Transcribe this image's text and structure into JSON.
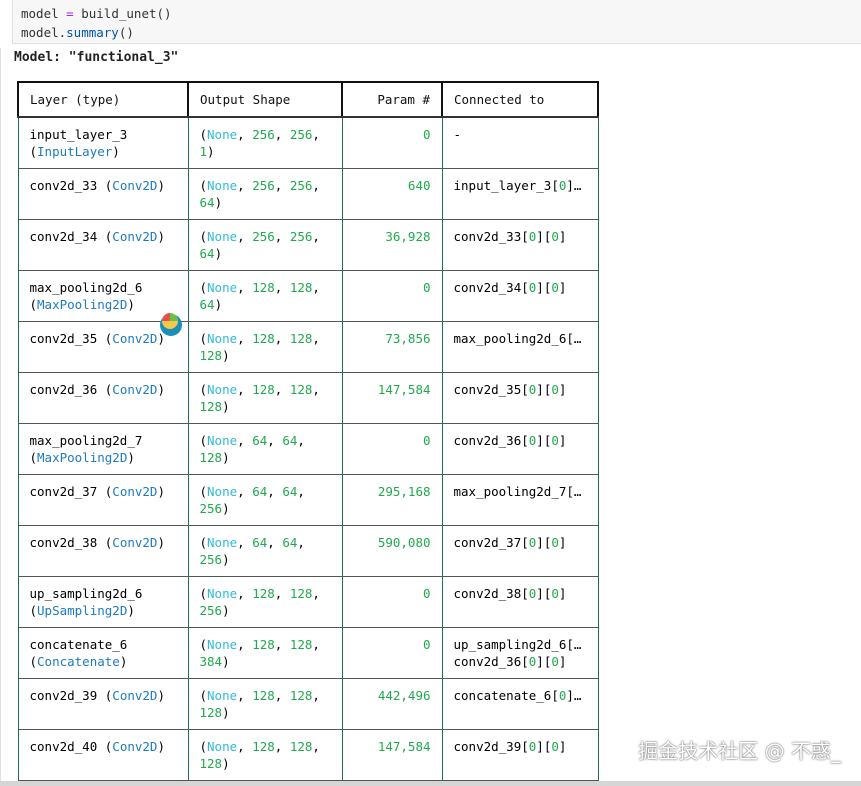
{
  "code": {
    "line1": {
      "var": "model",
      "op": "=",
      "fn": "build_unet",
      "args": "()"
    },
    "line2": {
      "obj": "model.",
      "fn": "summary",
      "args": "()"
    }
  },
  "model_title": "Model: \"functional_3\"",
  "table": {
    "headers": [
      "Layer (type)",
      "Output Shape",
      "Param #",
      "Connected to"
    ],
    "rows": [
      {
        "name": "input_layer_3",
        "type": "InputLayer",
        "type_wrap": true,
        "d1": "256",
        "d2": "256",
        "d3": "1",
        "params": "0",
        "connected": [
          "-"
        ]
      },
      {
        "name": "conv2d_33",
        "type": "Conv2D",
        "type_wrap": false,
        "d1": "256",
        "d2": "256",
        "d3": "64",
        "params": "640",
        "connected": [
          "input_layer_3[0]…"
        ]
      },
      {
        "name": "conv2d_34",
        "type": "Conv2D",
        "type_wrap": false,
        "d1": "256",
        "d2": "256",
        "d3": "64",
        "params": "36,928",
        "connected": [
          "conv2d_33[0][0]"
        ]
      },
      {
        "name": "max_pooling2d_6",
        "type": "MaxPooling2D",
        "type_wrap": true,
        "d1": "128",
        "d2": "128",
        "d3": "64",
        "params": "0",
        "connected": [
          "conv2d_34[0][0]"
        ]
      },
      {
        "name": "conv2d_35",
        "type": "Conv2D",
        "type_wrap": false,
        "d1": "128",
        "d2": "128",
        "d3": "128",
        "params": "73,856",
        "connected": [
          "max_pooling2d_6[…"
        ]
      },
      {
        "name": "conv2d_36",
        "type": "Conv2D",
        "type_wrap": false,
        "d1": "128",
        "d2": "128",
        "d3": "128",
        "params": "147,584",
        "connected": [
          "conv2d_35[0][0]"
        ]
      },
      {
        "name": "max_pooling2d_7",
        "type": "MaxPooling2D",
        "type_wrap": true,
        "d1": "64",
        "d2": "64",
        "d3": "128",
        "params": "0",
        "connected": [
          "conv2d_36[0][0]"
        ]
      },
      {
        "name": "conv2d_37",
        "type": "Conv2D",
        "type_wrap": false,
        "d1": "64",
        "d2": "64",
        "d3": "256",
        "params": "295,168",
        "connected": [
          "max_pooling2d_7[…"
        ]
      },
      {
        "name": "conv2d_38",
        "type": "Conv2D",
        "type_wrap": false,
        "d1": "64",
        "d2": "64",
        "d3": "256",
        "params": "590,080",
        "connected": [
          "conv2d_37[0][0]"
        ]
      },
      {
        "name": "up_sampling2d_6",
        "type": "UpSampling2D",
        "type_wrap": true,
        "d1": "128",
        "d2": "128",
        "d3": "256",
        "params": "0",
        "connected": [
          "conv2d_38[0][0]"
        ]
      },
      {
        "name": "concatenate_6",
        "type": "Concatenate",
        "type_wrap": true,
        "d1": "128",
        "d2": "128",
        "d3": "384",
        "params": "0",
        "connected": [
          "up_sampling2d_6[…",
          "conv2d_36[0][0]"
        ]
      },
      {
        "name": "conv2d_39",
        "type": "Conv2D",
        "type_wrap": false,
        "d1": "128",
        "d2": "128",
        "d3": "128",
        "params": "442,496",
        "connected": [
          "concatenate_6[0]…"
        ]
      },
      {
        "name": "conv2d_40",
        "type": "Conv2D",
        "type_wrap": false,
        "d1": "128",
        "d2": "128",
        "d3": "128",
        "params": "147,584",
        "connected": [
          "conv2d_39[0][0]"
        ]
      }
    ]
  },
  "none_label": "None",
  "watermark": "掘金技术社区 @ 不惑_",
  "colors": {
    "class": "#1d7bbf",
    "none": "#31b9d8",
    "number": "#1faa4c"
  }
}
